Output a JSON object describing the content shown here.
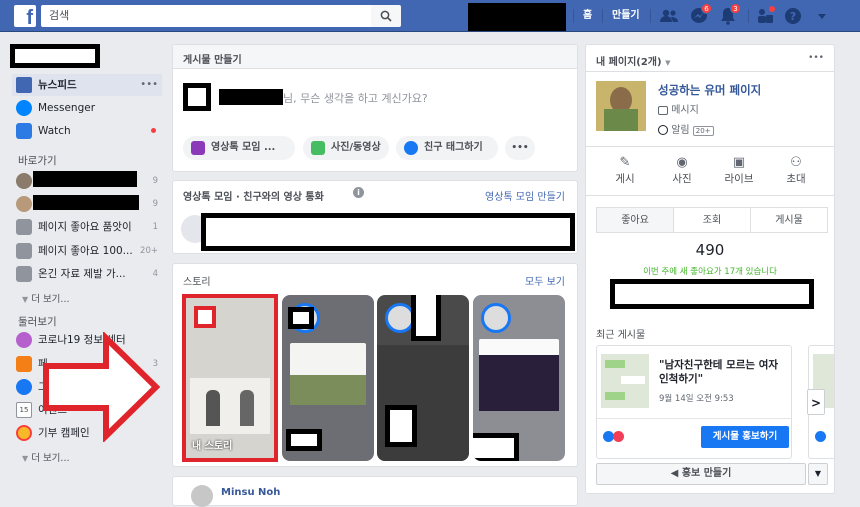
{
  "topbar": {
    "search_placeholder": "검색",
    "nav_home": "홈",
    "nav_create": "만들기",
    "messenger_badge": "6",
    "notifications_badge": "3"
  },
  "left_nav": {
    "main_items": [
      {
        "label": "뉴스피드",
        "icon": "newsfeed-icon"
      },
      {
        "label": "Messenger",
        "icon": "messenger-icon"
      },
      {
        "label": "Watch",
        "icon": "watch-icon"
      }
    ],
    "shortcuts_header": "바로가기",
    "shortcuts": [
      {
        "label": "",
        "count": "9"
      },
      {
        "label": "",
        "count": "9"
      },
      {
        "label": "페이지 좋아요 품앗이",
        "count": "1"
      },
      {
        "label": "페이지 좋아요 100...",
        "count": "20+"
      },
      {
        "label": "온긴 자료 제발 가...",
        "count": "4"
      }
    ],
    "more_label_1": "더 보기...",
    "explore_header": "둘러보기",
    "explore": [
      {
        "label": "코로나19 정보 센터",
        "count": ""
      },
      {
        "label": "페",
        "count": "3"
      },
      {
        "label": "그",
        "count": ""
      },
      {
        "label": "이벤트",
        "count": ""
      },
      {
        "label": "기부 캠페인",
        "count": ""
      }
    ],
    "more_label_2": "더 보기..."
  },
  "composer": {
    "title": "게시물 만들기",
    "prompt": "님, 무슨 생각을 하고 계신가요?",
    "buttons": [
      "영상톡 모임 ...",
      "사진/동영상",
      "친구 태그하기"
    ],
    "more": "•••"
  },
  "rooms": {
    "title": "영상톡 모임 · 친구와의 영상 통화",
    "create_link": "영상톡 모임 만들기"
  },
  "stories": {
    "title": "스토리",
    "see_all": "모두 보기",
    "my_story": "내 스토리"
  },
  "feed": {
    "next_post_name": "Minsu Noh"
  },
  "right_panel": {
    "header": "내 페이지(2개)",
    "page_name": "성공하는 유머 페이지",
    "messages": "메시지",
    "notifications": "알림",
    "notif_count": "20+",
    "actions": [
      "게시",
      "사진",
      "라이브",
      "초대"
    ],
    "tabs": [
      "좋아요",
      "조회",
      "게시물"
    ],
    "likes_count": "490",
    "likes_note": "이번 주에 새 좋아요가 17개 있습니다",
    "recent_posts_title": "최근 게시물",
    "post_text": "\"남자친구한테 모르는 여자인척하기\"",
    "post_date": "9월 14일 오전 9:53",
    "boost_button": "게시물 홍보하기",
    "promote_button": "홍보 만들기"
  },
  "colors": {
    "topbar": "#4267b2",
    "link": "#4267b2",
    "annotation_red": "#e0242b"
  }
}
